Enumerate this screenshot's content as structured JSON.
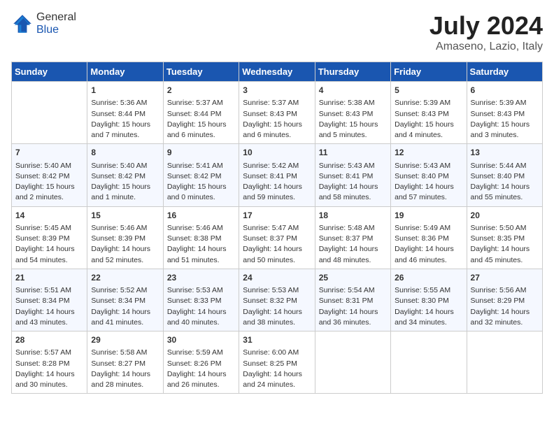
{
  "header": {
    "logo_general": "General",
    "logo_blue": "Blue",
    "month_title": "July 2024",
    "location": "Amaseno, Lazio, Italy"
  },
  "days_of_week": [
    "Sunday",
    "Monday",
    "Tuesday",
    "Wednesday",
    "Thursday",
    "Friday",
    "Saturday"
  ],
  "weeks": [
    [
      {
        "day": "",
        "info": ""
      },
      {
        "day": "1",
        "info": "Sunrise: 5:36 AM\nSunset: 8:44 PM\nDaylight: 15 hours\nand 7 minutes."
      },
      {
        "day": "2",
        "info": "Sunrise: 5:37 AM\nSunset: 8:44 PM\nDaylight: 15 hours\nand 6 minutes."
      },
      {
        "day": "3",
        "info": "Sunrise: 5:37 AM\nSunset: 8:43 PM\nDaylight: 15 hours\nand 6 minutes."
      },
      {
        "day": "4",
        "info": "Sunrise: 5:38 AM\nSunset: 8:43 PM\nDaylight: 15 hours\nand 5 minutes."
      },
      {
        "day": "5",
        "info": "Sunrise: 5:39 AM\nSunset: 8:43 PM\nDaylight: 15 hours\nand 4 minutes."
      },
      {
        "day": "6",
        "info": "Sunrise: 5:39 AM\nSunset: 8:43 PM\nDaylight: 15 hours\nand 3 minutes."
      }
    ],
    [
      {
        "day": "7",
        "info": "Sunrise: 5:40 AM\nSunset: 8:42 PM\nDaylight: 15 hours\nand 2 minutes."
      },
      {
        "day": "8",
        "info": "Sunrise: 5:40 AM\nSunset: 8:42 PM\nDaylight: 15 hours\nand 1 minute."
      },
      {
        "day": "9",
        "info": "Sunrise: 5:41 AM\nSunset: 8:42 PM\nDaylight: 15 hours\nand 0 minutes."
      },
      {
        "day": "10",
        "info": "Sunrise: 5:42 AM\nSunset: 8:41 PM\nDaylight: 14 hours\nand 59 minutes."
      },
      {
        "day": "11",
        "info": "Sunrise: 5:43 AM\nSunset: 8:41 PM\nDaylight: 14 hours\nand 58 minutes."
      },
      {
        "day": "12",
        "info": "Sunrise: 5:43 AM\nSunset: 8:40 PM\nDaylight: 14 hours\nand 57 minutes."
      },
      {
        "day": "13",
        "info": "Sunrise: 5:44 AM\nSunset: 8:40 PM\nDaylight: 14 hours\nand 55 minutes."
      }
    ],
    [
      {
        "day": "14",
        "info": "Sunrise: 5:45 AM\nSunset: 8:39 PM\nDaylight: 14 hours\nand 54 minutes."
      },
      {
        "day": "15",
        "info": "Sunrise: 5:46 AM\nSunset: 8:39 PM\nDaylight: 14 hours\nand 52 minutes."
      },
      {
        "day": "16",
        "info": "Sunrise: 5:46 AM\nSunset: 8:38 PM\nDaylight: 14 hours\nand 51 minutes."
      },
      {
        "day": "17",
        "info": "Sunrise: 5:47 AM\nSunset: 8:37 PM\nDaylight: 14 hours\nand 50 minutes."
      },
      {
        "day": "18",
        "info": "Sunrise: 5:48 AM\nSunset: 8:37 PM\nDaylight: 14 hours\nand 48 minutes."
      },
      {
        "day": "19",
        "info": "Sunrise: 5:49 AM\nSunset: 8:36 PM\nDaylight: 14 hours\nand 46 minutes."
      },
      {
        "day": "20",
        "info": "Sunrise: 5:50 AM\nSunset: 8:35 PM\nDaylight: 14 hours\nand 45 minutes."
      }
    ],
    [
      {
        "day": "21",
        "info": "Sunrise: 5:51 AM\nSunset: 8:34 PM\nDaylight: 14 hours\nand 43 minutes."
      },
      {
        "day": "22",
        "info": "Sunrise: 5:52 AM\nSunset: 8:34 PM\nDaylight: 14 hours\nand 41 minutes."
      },
      {
        "day": "23",
        "info": "Sunrise: 5:53 AM\nSunset: 8:33 PM\nDaylight: 14 hours\nand 40 minutes."
      },
      {
        "day": "24",
        "info": "Sunrise: 5:53 AM\nSunset: 8:32 PM\nDaylight: 14 hours\nand 38 minutes."
      },
      {
        "day": "25",
        "info": "Sunrise: 5:54 AM\nSunset: 8:31 PM\nDaylight: 14 hours\nand 36 minutes."
      },
      {
        "day": "26",
        "info": "Sunrise: 5:55 AM\nSunset: 8:30 PM\nDaylight: 14 hours\nand 34 minutes."
      },
      {
        "day": "27",
        "info": "Sunrise: 5:56 AM\nSunset: 8:29 PM\nDaylight: 14 hours\nand 32 minutes."
      }
    ],
    [
      {
        "day": "28",
        "info": "Sunrise: 5:57 AM\nSunset: 8:28 PM\nDaylight: 14 hours\nand 30 minutes."
      },
      {
        "day": "29",
        "info": "Sunrise: 5:58 AM\nSunset: 8:27 PM\nDaylight: 14 hours\nand 28 minutes."
      },
      {
        "day": "30",
        "info": "Sunrise: 5:59 AM\nSunset: 8:26 PM\nDaylight: 14 hours\nand 26 minutes."
      },
      {
        "day": "31",
        "info": "Sunrise: 6:00 AM\nSunset: 8:25 PM\nDaylight: 14 hours\nand 24 minutes."
      },
      {
        "day": "",
        "info": ""
      },
      {
        "day": "",
        "info": ""
      },
      {
        "day": "",
        "info": ""
      }
    ]
  ]
}
